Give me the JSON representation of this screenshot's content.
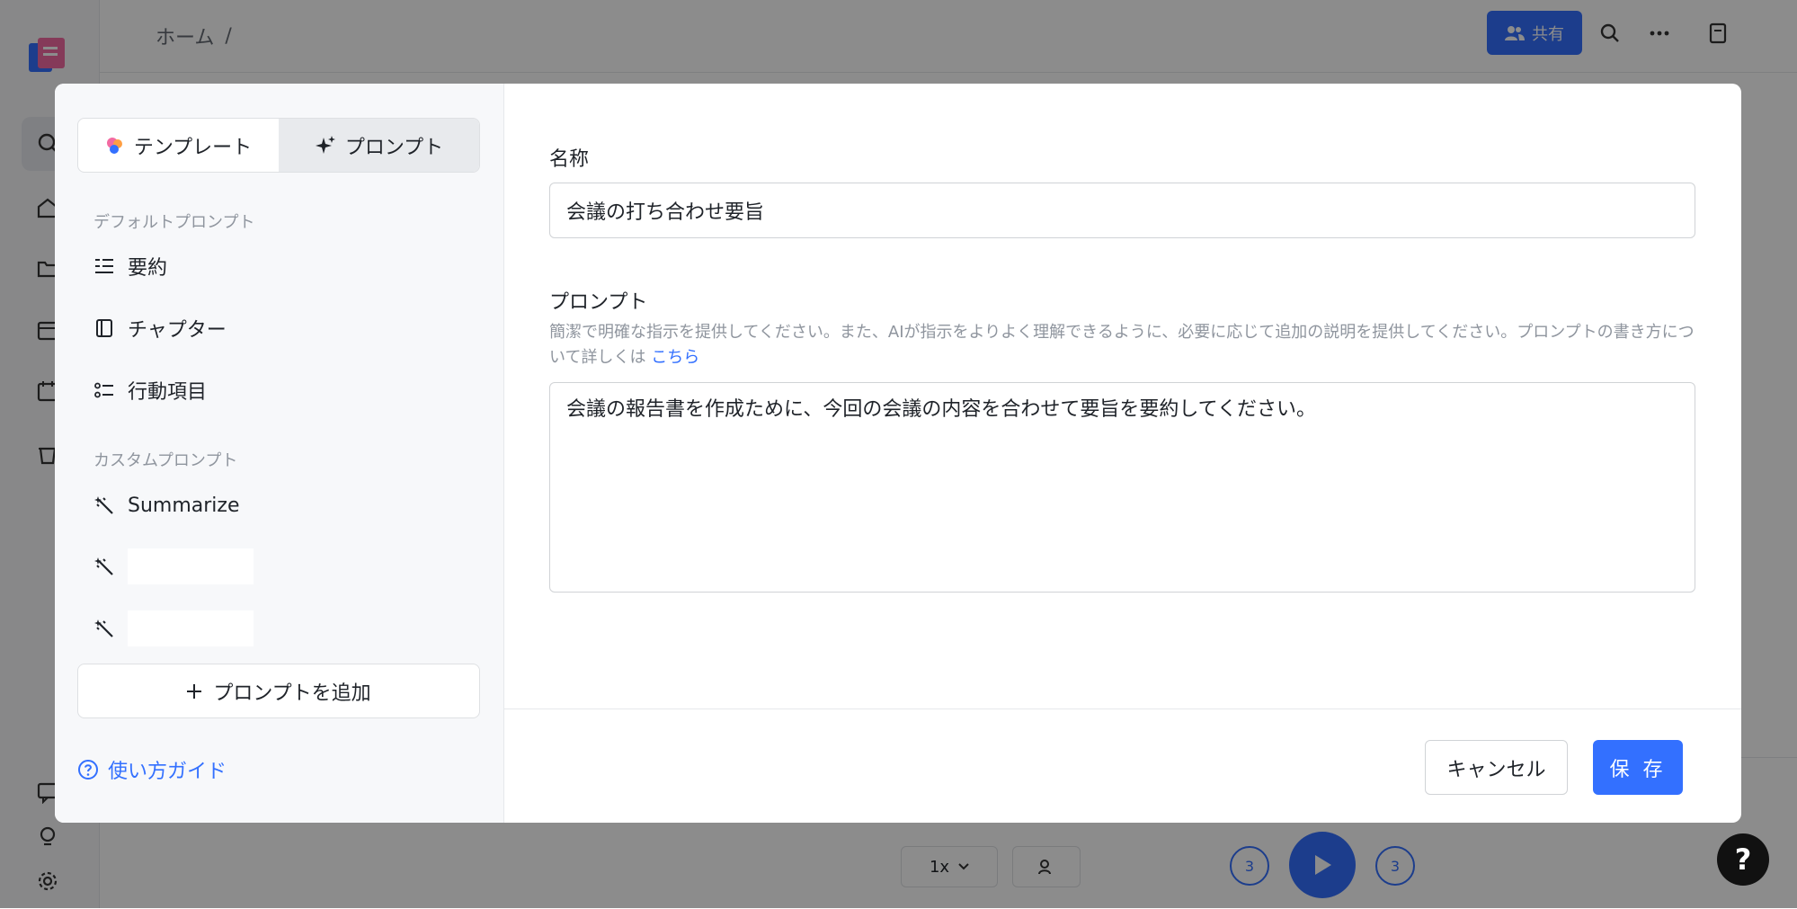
{
  "app": {
    "breadcrumb": {
      "home": "ホーム",
      "separator": "/"
    },
    "share_label": "共有",
    "player": {
      "speed": "1x",
      "skip_back": "3",
      "skip_forward": "3"
    },
    "help_fab": "?"
  },
  "modal": {
    "tabs": [
      {
        "label": "テンプレート",
        "icon": "template-palette-icon",
        "active": false
      },
      {
        "label": "プロンプト",
        "icon": "sparkle-icon",
        "active": true
      }
    ],
    "default_group_title": "デフォルトプロンプト",
    "default_prompts": [
      {
        "label": "要約",
        "icon": "summary-lines-icon"
      },
      {
        "label": "チャプター",
        "icon": "chapter-book-icon"
      },
      {
        "label": "行動項目",
        "icon": "checklist-icon"
      }
    ],
    "custom_group_title": "カスタムプロンプト",
    "custom_prompts": [
      {
        "label": "Summarize",
        "icon": "magic-wand-icon"
      },
      {
        "label": "",
        "icon": "magic-wand-icon"
      },
      {
        "label": "",
        "icon": "magic-wand-icon"
      }
    ],
    "add_prompt_label": "プロンプトを追加",
    "guide_label": "使い方ガイド",
    "name_label": "名称",
    "name_value": "会議の打ち合わせ要旨",
    "prompt_label": "プロンプト",
    "prompt_help": "簡潔で明確な指示を提供してください。また、AIが指示をよりよく理解できるように、必要に応じて追加の説明を提供してください。プロンプトの書き方について詳しくは",
    "prompt_help_link": "こちら",
    "prompt_value": "会議の報告書を作成ために、今回の会議の内容を合わせて要旨を要約してください。",
    "cancel_label": "キャンセル",
    "save_label": "保 存"
  },
  "colors": {
    "accent": "#3370ff",
    "overlay": "rgba(0,0,0,0.45)",
    "panel": "#f7f8fa"
  }
}
